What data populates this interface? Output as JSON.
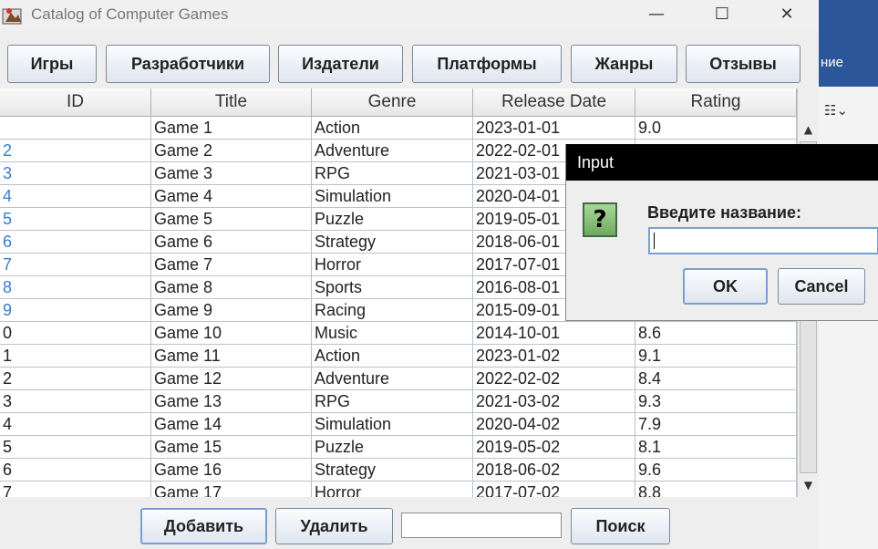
{
  "window": {
    "title": "Catalog of Computer Games",
    "controls": {
      "minimize": "—",
      "maximize": "☐",
      "close": "✕"
    }
  },
  "background_app": {
    "ribbon_text": "ние"
  },
  "nav": {
    "buttons": [
      "Игры",
      "Разработчики",
      "Издатели",
      "Платформы",
      "Жанры",
      "Отзывы"
    ]
  },
  "table": {
    "columns": [
      "ID",
      "Title",
      "Genre",
      "Release Date",
      "Rating"
    ],
    "rows": [
      [
        "",
        "Game 1",
        "Action",
        "2023-01-01",
        "9.0"
      ],
      [
        "2",
        "Game 2",
        "Adventure",
        "2022-02-01",
        ""
      ],
      [
        "3",
        "Game 3",
        "RPG",
        "2021-03-01",
        ""
      ],
      [
        "4",
        "Game 4",
        "Simulation",
        "2020-04-01",
        ""
      ],
      [
        "5",
        "Game 5",
        "Puzzle",
        "2019-05-01",
        ""
      ],
      [
        "6",
        "Game 6",
        "Strategy",
        "2018-06-01",
        ""
      ],
      [
        "7",
        "Game 7",
        "Horror",
        "2017-07-01",
        ""
      ],
      [
        "8",
        "Game 8",
        "Sports",
        "2016-08-01",
        ""
      ],
      [
        "9",
        "Game 9",
        "Racing",
        "2015-09-01",
        ""
      ],
      [
        "0",
        "Game 10",
        "Music",
        "2014-10-01",
        "8.6"
      ],
      [
        "1",
        "Game 11",
        "Action",
        "2023-01-02",
        "9.1"
      ],
      [
        "2",
        "Game 12",
        "Adventure",
        "2022-02-02",
        "8.4"
      ],
      [
        "3",
        "Game 13",
        "RPG",
        "2021-03-02",
        "9.3"
      ],
      [
        "4",
        "Game 14",
        "Simulation",
        "2020-04-02",
        "7.9"
      ],
      [
        "5",
        "Game 15",
        "Puzzle",
        "2019-05-02",
        "8.1"
      ],
      [
        "6",
        "Game 16",
        "Strategy",
        "2018-06-02",
        "9.6"
      ],
      [
        "7",
        "Game 17",
        "Horror",
        "2017-07-02",
        "8.8"
      ]
    ]
  },
  "bottom": {
    "add_label": "Добавить",
    "delete_label": "Удалить",
    "search_value": "",
    "search_label": "Поиск"
  },
  "dialog": {
    "title": "Input",
    "icon_glyph": "?",
    "prompt": "Введите название:",
    "input_value": "",
    "ok_label": "OK",
    "cancel_label": "Cancel"
  },
  "colors": {
    "accent": "#2b579a",
    "id_faded": "#3a7bd5"
  }
}
